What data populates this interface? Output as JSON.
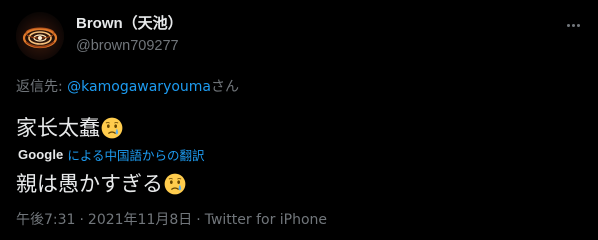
{
  "author": {
    "display_name": "Brown（天池）",
    "handle": "@brown709277"
  },
  "reply": {
    "prefix": "返信先: ",
    "mention": "@kamogawaryouma",
    "suffix": "さん"
  },
  "tweet": {
    "original_text": "家长太蠢",
    "translated_text": "親は愚かすぎる",
    "emoji": "crying-face-emoji"
  },
  "translation": {
    "provider": "Google",
    "label": "による中国語からの翻訳"
  },
  "meta": {
    "time": "午後7:31",
    "separator": "·",
    "date": "2021年11月8日",
    "source": "Twitter for iPhone"
  },
  "icons": {
    "more": "more-dots-icon"
  },
  "colors": {
    "background": "#000000",
    "text_primary": "#e7e9ea",
    "text_secondary": "#71767b",
    "link": "#1d9bf0",
    "emoji_face": "#ffcc4d"
  }
}
